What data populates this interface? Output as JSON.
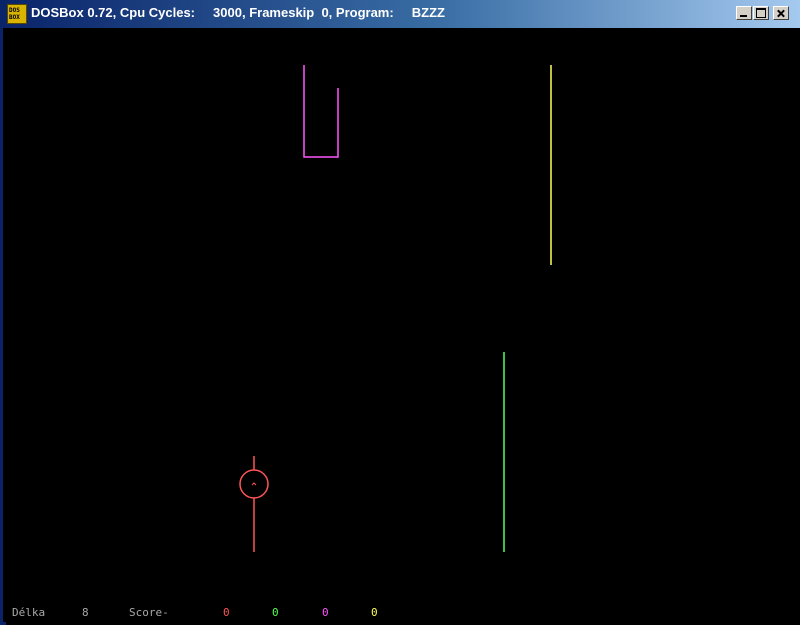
{
  "window": {
    "title": "DOSBox 0.72, Cpu Cycles:     3000, Frameskip  0, Program:     BZZZ",
    "icon_text": "DOS BOX",
    "minimize_icon": "minimize-icon",
    "maximize_icon": "maximize-icon",
    "close_icon": "close-icon"
  },
  "hud": {
    "length_label": "Délka",
    "length_value": "8",
    "score_label": "Score-",
    "scores": [
      {
        "value": "0",
        "color": "#ff5555"
      },
      {
        "value": "0",
        "color": "#55ff55"
      },
      {
        "value": "0",
        "color": "#ff55ff"
      },
      {
        "value": "0",
        "color": "#ffff55"
      }
    ]
  },
  "game": {
    "players": [
      {
        "name": "red",
        "color": "#ff5555"
      },
      {
        "name": "green",
        "color": "#55ff55"
      },
      {
        "name": "magenta",
        "color": "#ff55ff"
      },
      {
        "name": "yellow",
        "color": "#ffff55"
      }
    ]
  }
}
